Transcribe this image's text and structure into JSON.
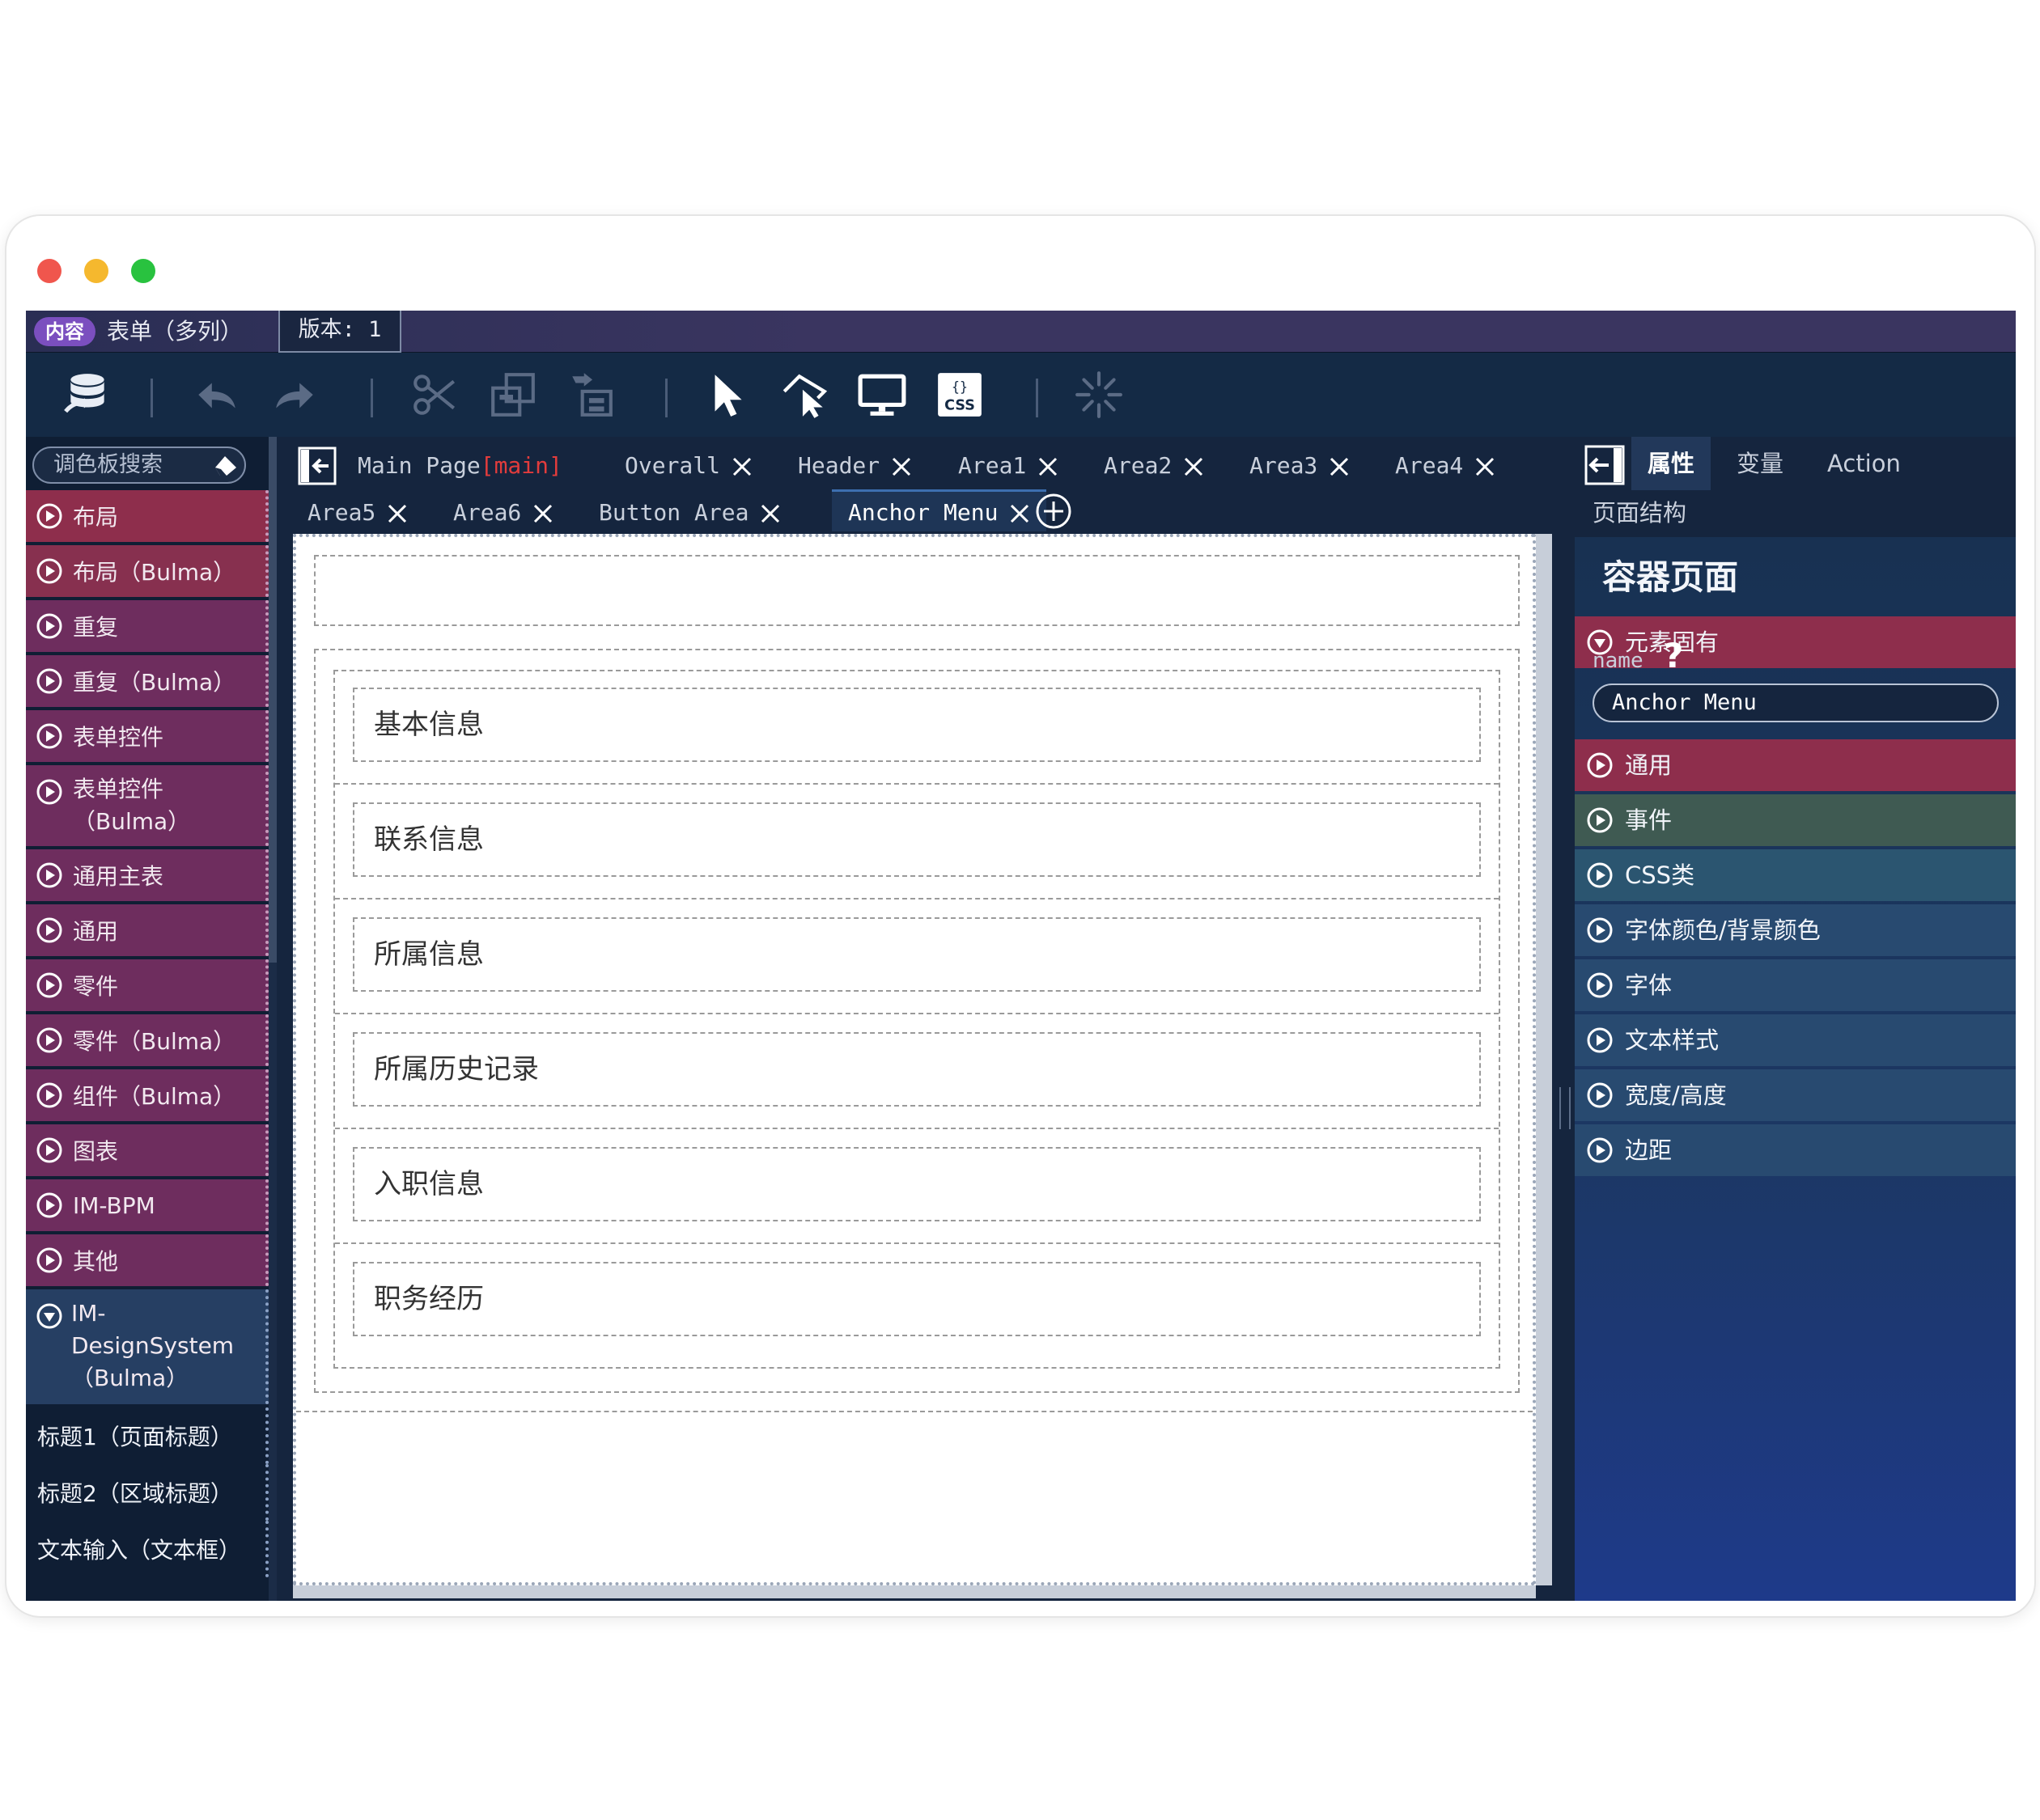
{
  "window": {
    "buttons": [
      "close",
      "minimize",
      "maximize"
    ]
  },
  "topbar": {
    "badge": "内容",
    "title": "表单（多列）",
    "version": "版本: 1"
  },
  "toolbar": {
    "icons": [
      "database-import-icon",
      "undo-icon",
      "redo-icon",
      "cut-icon",
      "group-icon",
      "ungroup-icon",
      "select-pointer-icon",
      "hover-select-icon",
      "preview-monitor-icon",
      "css-icon",
      "loading-spinner-icon"
    ]
  },
  "sidebar": {
    "search_placeholder": "调色板搜索",
    "categories": [
      {
        "label": "布局"
      },
      {
        "label": "布局（Bulma）"
      },
      {
        "label": "重复"
      },
      {
        "label": "重复（Bulma）"
      },
      {
        "label": "表单控件"
      },
      {
        "label": "表单控件（Bulma）"
      },
      {
        "label": "通用主表"
      },
      {
        "label": "通用"
      },
      {
        "label": "零件"
      },
      {
        "label": "零件（Bulma）"
      },
      {
        "label": "组件（Bulma）"
      },
      {
        "label": "图表"
      },
      {
        "label": "IM-BPM"
      },
      {
        "label": "其他"
      }
    ],
    "expanded": {
      "label": "IM-DesignSystem（Bulma）",
      "items": [
        "标题1（页面标题）",
        "标题2（区域标题）",
        "文本输入（文本框）"
      ]
    }
  },
  "tabs": {
    "row1": [
      {
        "label": "Main Page",
        "suffix": "[main]"
      },
      {
        "label": "Overall"
      },
      {
        "label": "Header"
      },
      {
        "label": "Area1"
      },
      {
        "label": "Area2"
      },
      {
        "label": "Area3"
      },
      {
        "label": "Area4"
      }
    ],
    "row2": [
      {
        "label": "Area5"
      },
      {
        "label": "Area6"
      },
      {
        "label": "Button Area"
      },
      {
        "label": "Anchor Menu"
      }
    ]
  },
  "canvas": {
    "anchor_items": [
      "基本信息",
      "联系信息",
      "所属信息",
      "所属历史记录",
      "入职信息",
      "职务经历"
    ]
  },
  "properties": {
    "tabs": [
      "属性",
      "变量",
      "Action"
    ],
    "structure_tab": "页面结构",
    "title": "容器页面",
    "sections": [
      {
        "label": "元素固有",
        "color": "#8e2e4c",
        "expanded": true
      },
      {
        "label": "通用",
        "color": "#8e2e4c"
      },
      {
        "label": "事件",
        "color": "#3f5a52"
      },
      {
        "label": "CSS类",
        "color": "#2b5570"
      },
      {
        "label": "字体颜色/背景颜色",
        "color": "#284a70"
      },
      {
        "label": "字体",
        "color": "#284a70"
      },
      {
        "label": "文本样式",
        "color": "#284a70"
      },
      {
        "label": "宽度/高度",
        "color": "#284a70"
      },
      {
        "label": "边距",
        "color": "#284a70"
      }
    ],
    "name_label": "name",
    "help": "?",
    "name_value": "Anchor Menu"
  }
}
